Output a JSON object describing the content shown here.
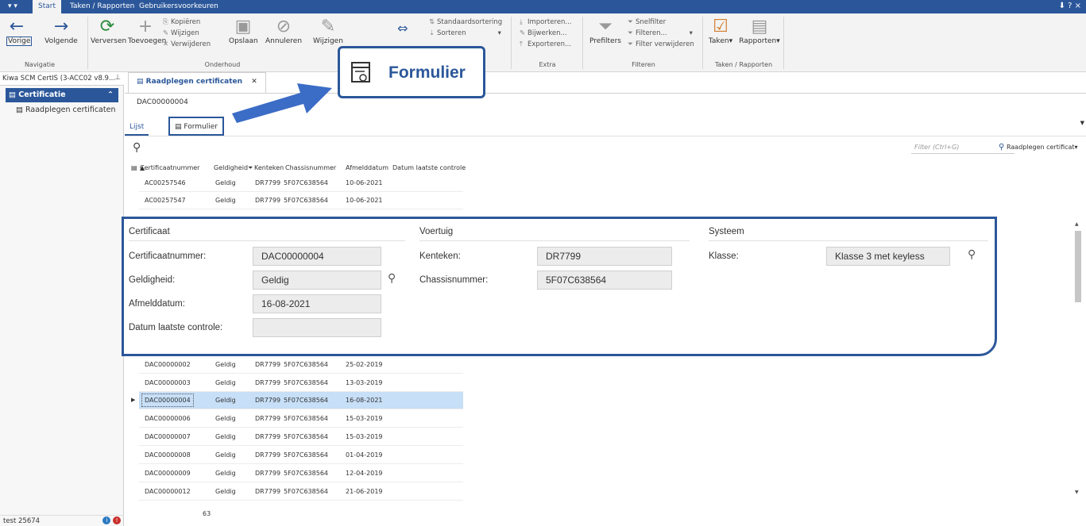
{
  "menubar": {
    "tabs": [
      "Start",
      "Taken / Rapporten",
      "Gebruikersvoorkeuren"
    ],
    "help": "? "
  },
  "ribbon": {
    "nav": {
      "back": "Vorige",
      "forward": "Volgende",
      "group": "Navigatie"
    },
    "refresh": "Verversen",
    "maintenance": {
      "add": "Toevoegen",
      "copy": "Kopiëren",
      "edit": "Wijzigen",
      "delete": "Verwijderen",
      "save": "Opslaan",
      "cancel": "Annuleren",
      "edit_form": "Wijzigen",
      "group": "Onderhoud"
    },
    "sort": {
      "default": "Standaardsortering",
      "sort": "Sorteren"
    },
    "extra": {
      "import": "Importeren...",
      "update": "Bijwerken...",
      "export": "Exporteren...",
      "group": "Extra"
    },
    "filters": {
      "prefilters": "Prefilters",
      "quick": "Snelfilter",
      "filter": "Filteren...",
      "remove": "Filter verwijderen",
      "group": "Filteren"
    },
    "tasks": {
      "tasks": "Taken",
      "reports": "Rapporten",
      "group": "Taken / Rapporten"
    }
  },
  "left": {
    "header": "Kiwa SCM CertIS (3-ACC02 v8.9...",
    "section": "Certificatie",
    "item": "Raadplegen certificaten",
    "footer": "test 25674"
  },
  "main": {
    "doc_tab": "Raadplegen certificaten",
    "record_id": "DAC00000004",
    "tab_list": "Lijst",
    "tab_form": "Formulier",
    "filter_placeholder": "Filter (Ctrl+G)",
    "view_select": "Raadplegen certificat",
    "columns": [
      "Certificaatnummer",
      "Geldigheid",
      "Kenteken",
      "Chassisnummer",
      "Afmelddatum",
      "Datum laatste controle"
    ],
    "rows_top": [
      [
        "AC00257546",
        "Geldig",
        "DR7799",
        "5F07C638564",
        "10-06-2021"
      ],
      [
        "AC00257547",
        "Geldig",
        "DR7799",
        "5F07C638564",
        "10-06-2021"
      ]
    ],
    "rows_bottom": [
      [
        "DAC00000002",
        "Geldig",
        "DR7799",
        "5F07C638564",
        "25-02-2019"
      ],
      [
        "DAC00000003",
        "Geldig",
        "DR7799",
        "5F07C638564",
        "13-03-2019"
      ],
      [
        "DAC00000004",
        "Geldig",
        "DR7799",
        "5F07C638564",
        "16-08-2021"
      ],
      [
        "DAC00000006",
        "Geldig",
        "DR7799",
        "5F07C638564",
        "15-03-2019"
      ],
      [
        "DAC00000007",
        "Geldig",
        "DR7799",
        "5F07C638564",
        "15-03-2019"
      ],
      [
        "DAC00000008",
        "Geldig",
        "DR7799",
        "5F07C638564",
        "01-04-2019"
      ],
      [
        "DAC00000009",
        "Geldig",
        "DR7799",
        "5F07C638564",
        "12-04-2019"
      ],
      [
        "DAC00000012",
        "Geldig",
        "DR7799",
        "5F07C638564",
        "21-06-2019"
      ]
    ],
    "row_count": "63"
  },
  "callout": {
    "label": "Formulier"
  },
  "form": {
    "sections": {
      "certificate": "Certificaat",
      "vehicle": "Voertuig",
      "system": "Systeem"
    },
    "certificate_number": {
      "label": "Certificaatnummer:",
      "value": "DAC00000004"
    },
    "validity": {
      "label": "Geldigheid:",
      "value": "Geldig"
    },
    "deregistration_date": {
      "label": "Afmelddatum:",
      "value": "16-08-2021"
    },
    "last_check_date": {
      "label": "Datum laatste controle:",
      "value": ""
    },
    "license_plate": {
      "label": "Kenteken:",
      "value": "DR7799"
    },
    "chassis_number": {
      "label": "Chassisnummer:",
      "value": "5F07C638564"
    },
    "class": {
      "label": "Klasse:",
      "value": "Klasse 3 met keyless"
    }
  },
  "colors": {
    "accent": "#2b579a",
    "selection": "#c7dff7"
  }
}
